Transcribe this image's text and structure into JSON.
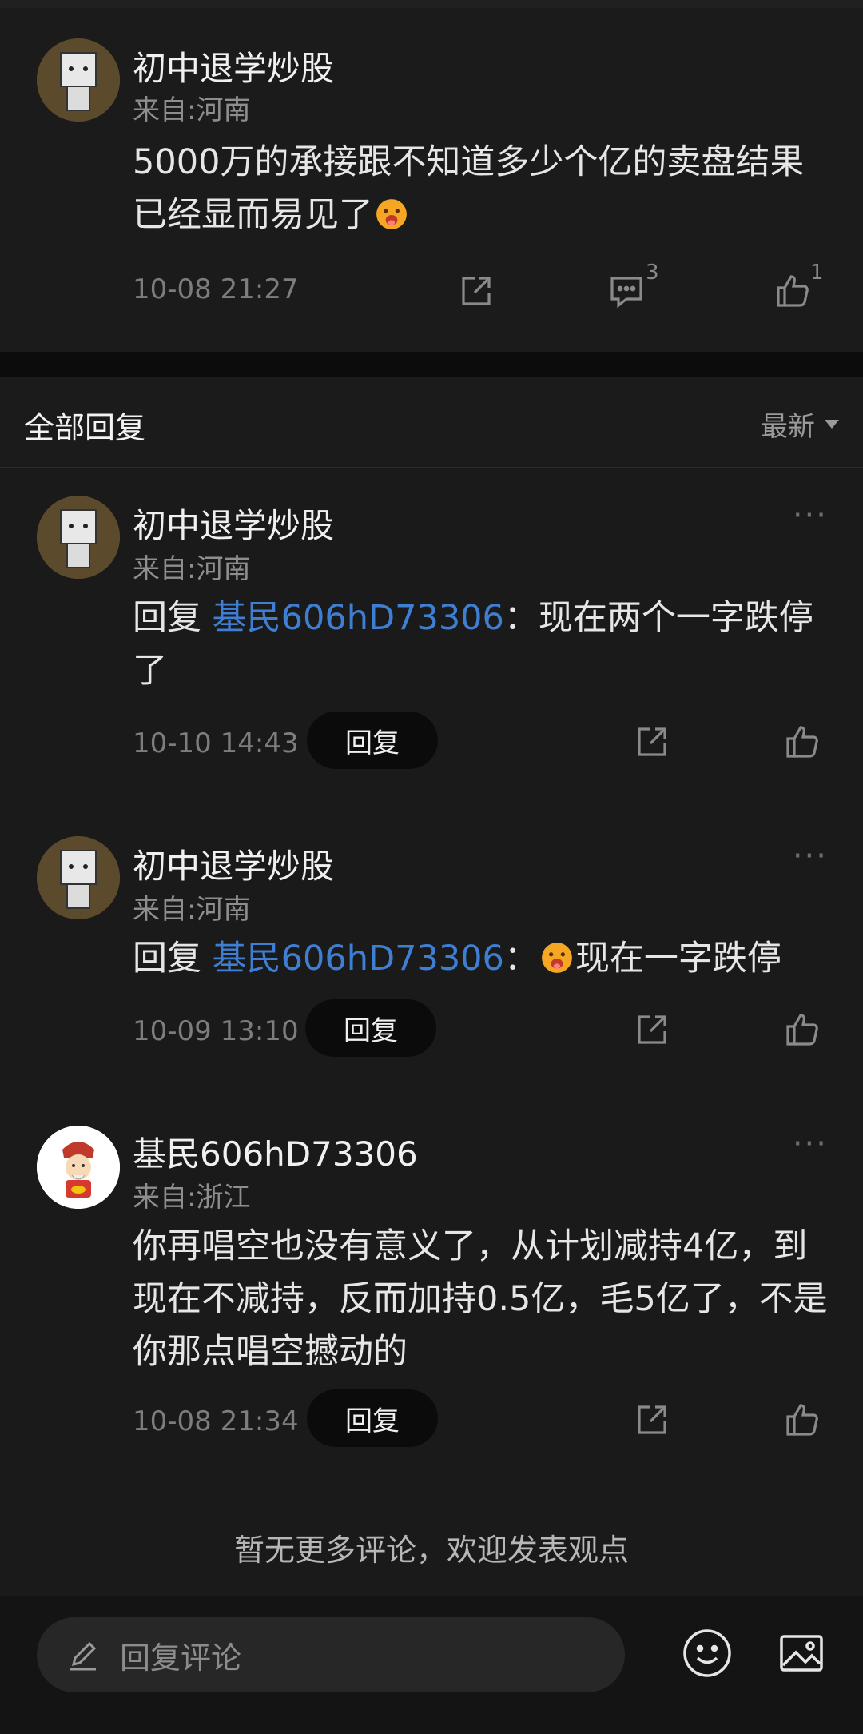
{
  "main_comment": {
    "username": "初中退学炒股",
    "location": "来自:河南",
    "text": "5000万的承接跟不知道多少个亿的卖盘结果已经显而易见了",
    "emoji": "hot-face-emoji",
    "timestamp": "10-08 21:27",
    "share_icon": "share-icon",
    "comment_icon": "comment-icon",
    "comment_count": "3",
    "like_icon": "thumbs-up-icon",
    "like_count": "1"
  },
  "replies_header": {
    "title": "全部回复",
    "sort_label": "最新"
  },
  "replies": [
    {
      "username": "初中退学炒股",
      "location": "来自:河南",
      "prefix": "回复 ",
      "mention": "基民606hD73306",
      "separator": "：",
      "text": "现在两个一字跌停了",
      "timestamp": "10-10 14:43",
      "reply_label": "回复"
    },
    {
      "username": "初中退学炒股",
      "location": "来自:河南",
      "prefix": "回复 ",
      "mention": "基民606hD73306",
      "separator": "：",
      "text": "现在一字跌停",
      "timestamp": "10-09 13:10",
      "reply_label": "回复"
    },
    {
      "username": "基民606hD73306",
      "location": "来自:浙江",
      "text": "你再唱空也没有意义了，从计划减持4亿，到现在不减持，反而加持0.5亿，毛5亿了，不是你那点唱空撼动的",
      "timestamp": "10-08 21:34",
      "reply_label": "回复"
    }
  ],
  "more_icon": "···",
  "footer_note": "暂无更多评论，欢迎发表观点",
  "bottom_bar": {
    "input_placeholder": "回复评论",
    "emoji_icon": "smiley-icon",
    "image_icon": "image-icon"
  },
  "colors": {
    "background": "#1a1a1a",
    "mention": "#3f7fd3",
    "text": "#e6e6e6",
    "muted": "#8e8e8e"
  }
}
